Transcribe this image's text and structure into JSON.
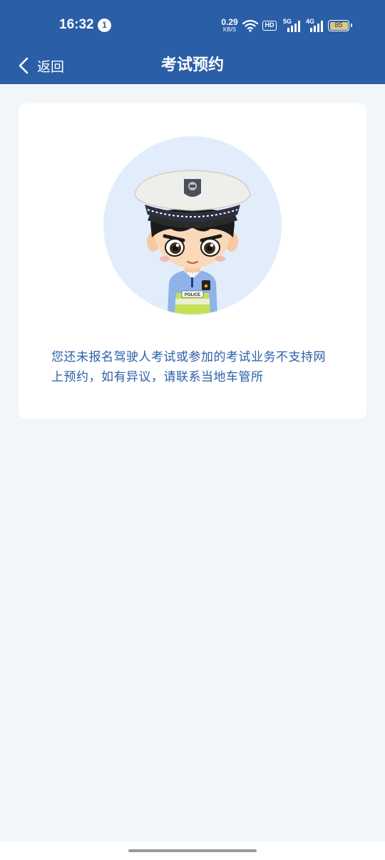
{
  "status_bar": {
    "time": "16:32",
    "notification_count": "1",
    "net_speed_value": "0.29",
    "net_speed_unit": "KB/S",
    "battery": "85",
    "signal_5g": "5G",
    "signal_4g": "4G",
    "hd_label": "HD"
  },
  "nav": {
    "back_label": "返回",
    "title": "考试预约"
  },
  "card": {
    "illustration_label": "POLICE",
    "message": "您还未报名驾驶人考试或参加的考试业务不支持网上预约，如有异议，请联系当地车管所"
  },
  "colors": {
    "header_bg": "#2a5fa8",
    "page_bg": "#f3f6f8",
    "accent_text": "#2a5fa8",
    "avatar_bg": "#e2edfb"
  }
}
